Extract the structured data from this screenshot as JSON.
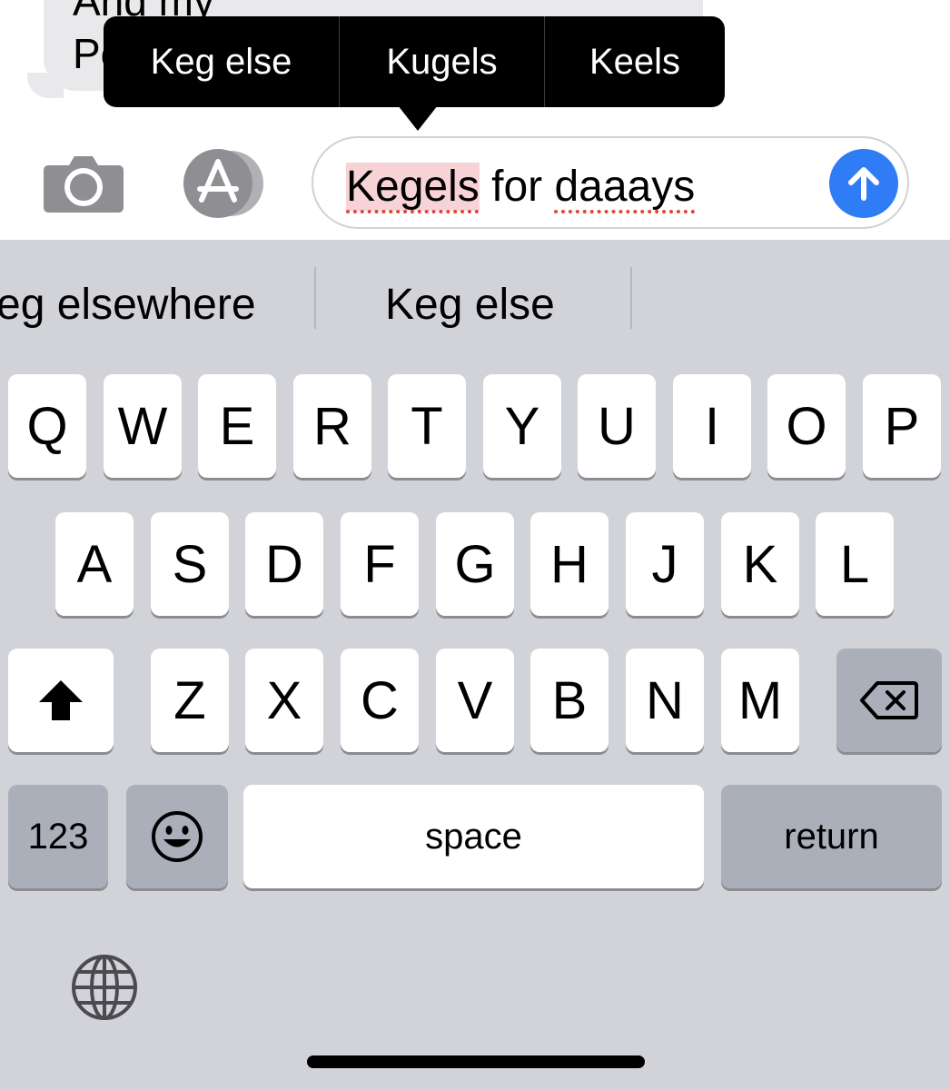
{
  "message": {
    "line1": "And my",
    "line2": "Pe"
  },
  "replacement_popover": {
    "options": [
      "Keg else",
      "Kugels",
      "Keels"
    ]
  },
  "input": {
    "word_highlighted": "Kegels",
    "rest": " for ",
    "word_misspelled": "daaays"
  },
  "predictive_bar": {
    "left": "eg elsewhere",
    "center": "Keg else"
  },
  "keyboard": {
    "row1": [
      "Q",
      "W",
      "E",
      "R",
      "T",
      "Y",
      "U",
      "I",
      "O",
      "P"
    ],
    "row2": [
      "A",
      "S",
      "D",
      "F",
      "G",
      "H",
      "J",
      "K",
      "L"
    ],
    "row3": [
      "Z",
      "X",
      "C",
      "V",
      "B",
      "N",
      "M"
    ],
    "numbers_key": "123",
    "space_key": "space",
    "return_key": "return"
  },
  "colors": {
    "send_button": "#2f7cf6",
    "keyboard_bg": "#d2d3d9",
    "misspell_highlight": "#f8d3d6"
  },
  "icons": [
    "camera-icon",
    "app-store-icon",
    "send-arrow-icon",
    "shift-icon",
    "delete-icon",
    "emoji-icon",
    "globe-icon"
  ]
}
